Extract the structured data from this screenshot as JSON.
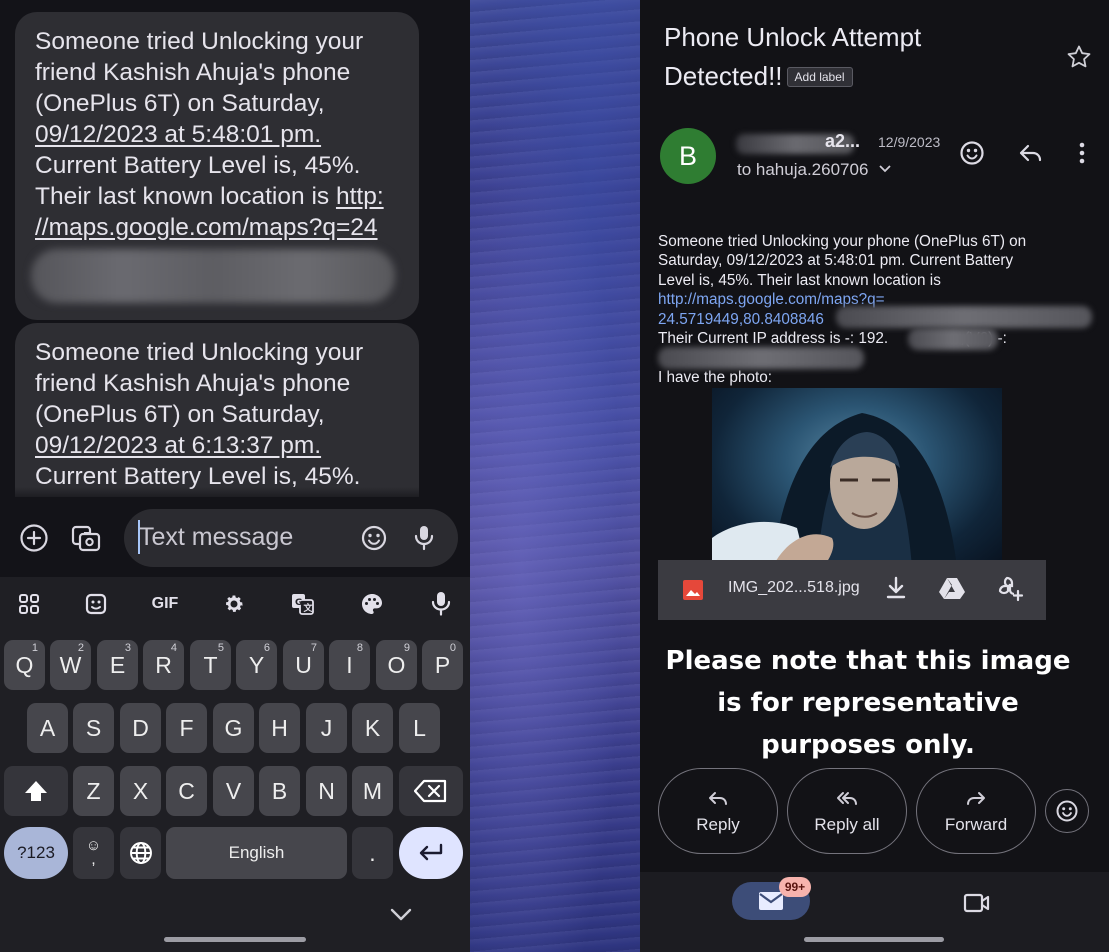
{
  "messages": {
    "bubble1": {
      "line1": "Someone tried Unlocking your",
      "line2": "friend Kashish Ahuja's phone",
      "line3": "(OnePlus 6T) on  Saturday,",
      "line4": "09/12/2023 at 5:48:01 pm.",
      "line5": "Current Battery Level is, 45%.",
      "line6a": "Their last known location is ",
      "line6b": "http:",
      "line7": "//maps.google.com/maps?q=24"
    },
    "bubble2": {
      "line1": "Someone tried Unlocking your",
      "line2": "friend Kashish Ahuja's phone",
      "line3": "(OnePlus 6T) on  Saturday,",
      "line4": "09/12/2023 at 6:13:37 pm.",
      "line5": "Current Battery Level is, 45%."
    }
  },
  "compose": {
    "placeholder": "Text message"
  },
  "keyboard": {
    "toolbar": [
      "apps-grid-icon",
      "sticker-icon",
      "GIF",
      "settings-gear-icon",
      "translate-icon",
      "theme-palette-icon",
      "voice-mic-icon"
    ],
    "gif_label": "GIF",
    "row1": [
      {
        "key": "Q",
        "num": "1"
      },
      {
        "key": "W",
        "num": "2"
      },
      {
        "key": "E",
        "num": "3"
      },
      {
        "key": "R",
        "num": "4"
      },
      {
        "key": "T",
        "num": "5"
      },
      {
        "key": "Y",
        "num": "6"
      },
      {
        "key": "U",
        "num": "7"
      },
      {
        "key": "I",
        "num": "8"
      },
      {
        "key": "O",
        "num": "9"
      },
      {
        "key": "P",
        "num": "0"
      }
    ],
    "row2": [
      "A",
      "S",
      "D",
      "F",
      "G",
      "H",
      "J",
      "K",
      "L"
    ],
    "row3": [
      "Z",
      "X",
      "C",
      "V",
      "B",
      "N",
      "M"
    ],
    "symbols_label": "?123",
    "emoji_comma": ",",
    "space_label": "English",
    "period_label": "."
  },
  "email": {
    "subject_line1": "Phone Unlock Attempt",
    "subject_line2": "Detected!!",
    "add_label": "Add label",
    "avatar_letter": "B",
    "sender_visible": "a2...",
    "date": "12/9/2023",
    "recipient": "to hahuja.260706",
    "body": {
      "line1": "Someone tried Unlocking your phone (OnePlus 6T) on",
      "line2": "Saturday, 09/12/2023 at 5:48:01 pm. Current Battery",
      "line3": "Level is, 45%. Their last known location is",
      "link1": "http://maps.google.com/maps?q=",
      "link2": "24.5719449,80.8408846",
      "ip_prefix": "Their Current IP address is -: 192.",
      "ip_suffix": "",
      "ip_v6": ",(V6) -:",
      "photo_line": "I have the photo:"
    },
    "attachment": {
      "name": "IMG_202...518.jpg"
    },
    "note": {
      "line1": "Please note that this image",
      "line2": "is for representative",
      "line3": "purposes only."
    },
    "actions": {
      "reply": "Reply",
      "reply_all": "Reply all",
      "forward": "Forward"
    },
    "nav": {
      "badge": "99+"
    }
  },
  "colors": {
    "avatar": "#2f7d32",
    "link": "#7ea6f2",
    "badge": "#f7b3ad",
    "mail_pill": "#3d4d78"
  }
}
